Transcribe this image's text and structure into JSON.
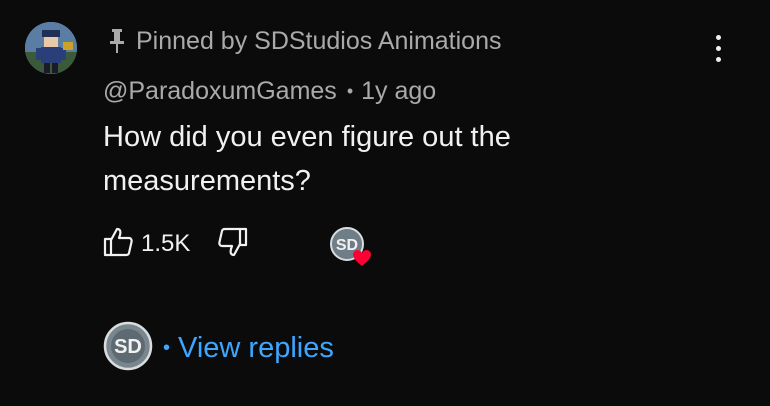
{
  "comment": {
    "pinned_label": "Pinned by SDStudios Animations",
    "author": "@ParadoxumGames",
    "separator": "•",
    "time": "1y ago",
    "text": "How did you even figure out the measurements?",
    "like_count": "1.5K",
    "menu_icon": "more-vert-icon",
    "pin_icon": "pin-icon",
    "like_icon": "thumbs-up-icon",
    "dislike_icon": "thumbs-down-icon",
    "heart_color": "#ff0033"
  },
  "replies": {
    "separator": "•",
    "label": "View replies",
    "color": "#3ea6ff"
  },
  "creator": {
    "initials": "SD"
  }
}
